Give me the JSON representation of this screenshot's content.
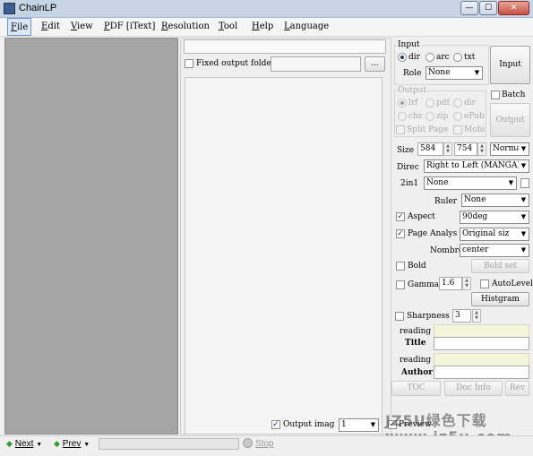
{
  "window": {
    "title": "ChainLP",
    "minimize": "—",
    "maximize": "☐",
    "close": "✕"
  },
  "menu": [
    "File",
    "Edit",
    "View",
    "PDF [iText]",
    "Resolution",
    "Tool",
    "Help",
    "Language"
  ],
  "middle": {
    "fixed_output_folder": "Fixed output folde",
    "browse": "...",
    "output_image": "Output imag",
    "output_image_value": "1"
  },
  "input_group": {
    "title": "Input",
    "radios": [
      "dir",
      "arc",
      "txt"
    ],
    "selected": "dir",
    "role_label": "Role",
    "role_value": "None",
    "input_button": "Input"
  },
  "output_group": {
    "title": "Output",
    "radios": [
      "lrf",
      "pdf",
      "dir",
      "cbz",
      "zip",
      "ePub"
    ],
    "split_page": "Split Page",
    "mobi": "Mobi",
    "batch": "Batch",
    "output_button": "Output"
  },
  "size": {
    "label": "Size",
    "width": "584",
    "height": "754",
    "mode": "Normal"
  },
  "direc": {
    "label": "Direc",
    "value": "Right to Left (MANGA)"
  },
  "twoin1": {
    "label": "2in1",
    "value": "None"
  },
  "ruler": {
    "label": "Ruler",
    "value": "None"
  },
  "aspect": {
    "label": "Aspect",
    "value": "90deg"
  },
  "page_analysis": {
    "label": "Page Analys",
    "value": "Original siz"
  },
  "nombre": {
    "label": "Nombre",
    "value": "center"
  },
  "bold": {
    "label": "Bold",
    "button": "Bold set"
  },
  "gamma": {
    "label": "Gamma",
    "value": "1.6",
    "autolevel": "AutoLevel",
    "histogram": "Histgram"
  },
  "sharpness": {
    "label": "Sharpness",
    "value": "3"
  },
  "meta": {
    "reading1": "reading",
    "title": "Title",
    "reading2": "reading",
    "author": "Author"
  },
  "buttons": {
    "toc": "TOC",
    "doc_info": "Doc Info",
    "rev": "Rev"
  },
  "preview": "Preview",
  "status": {
    "next": "Next",
    "prev": "Prev",
    "stop": "Stop"
  },
  "watermark": {
    "line1": "JZ5U绿色下载",
    "line2": "www.jz5u.com"
  },
  "colors": {
    "titlebar": "#c6d4e6",
    "left_panel": "#a5a5a5",
    "note_field": "#f5f5dc"
  }
}
